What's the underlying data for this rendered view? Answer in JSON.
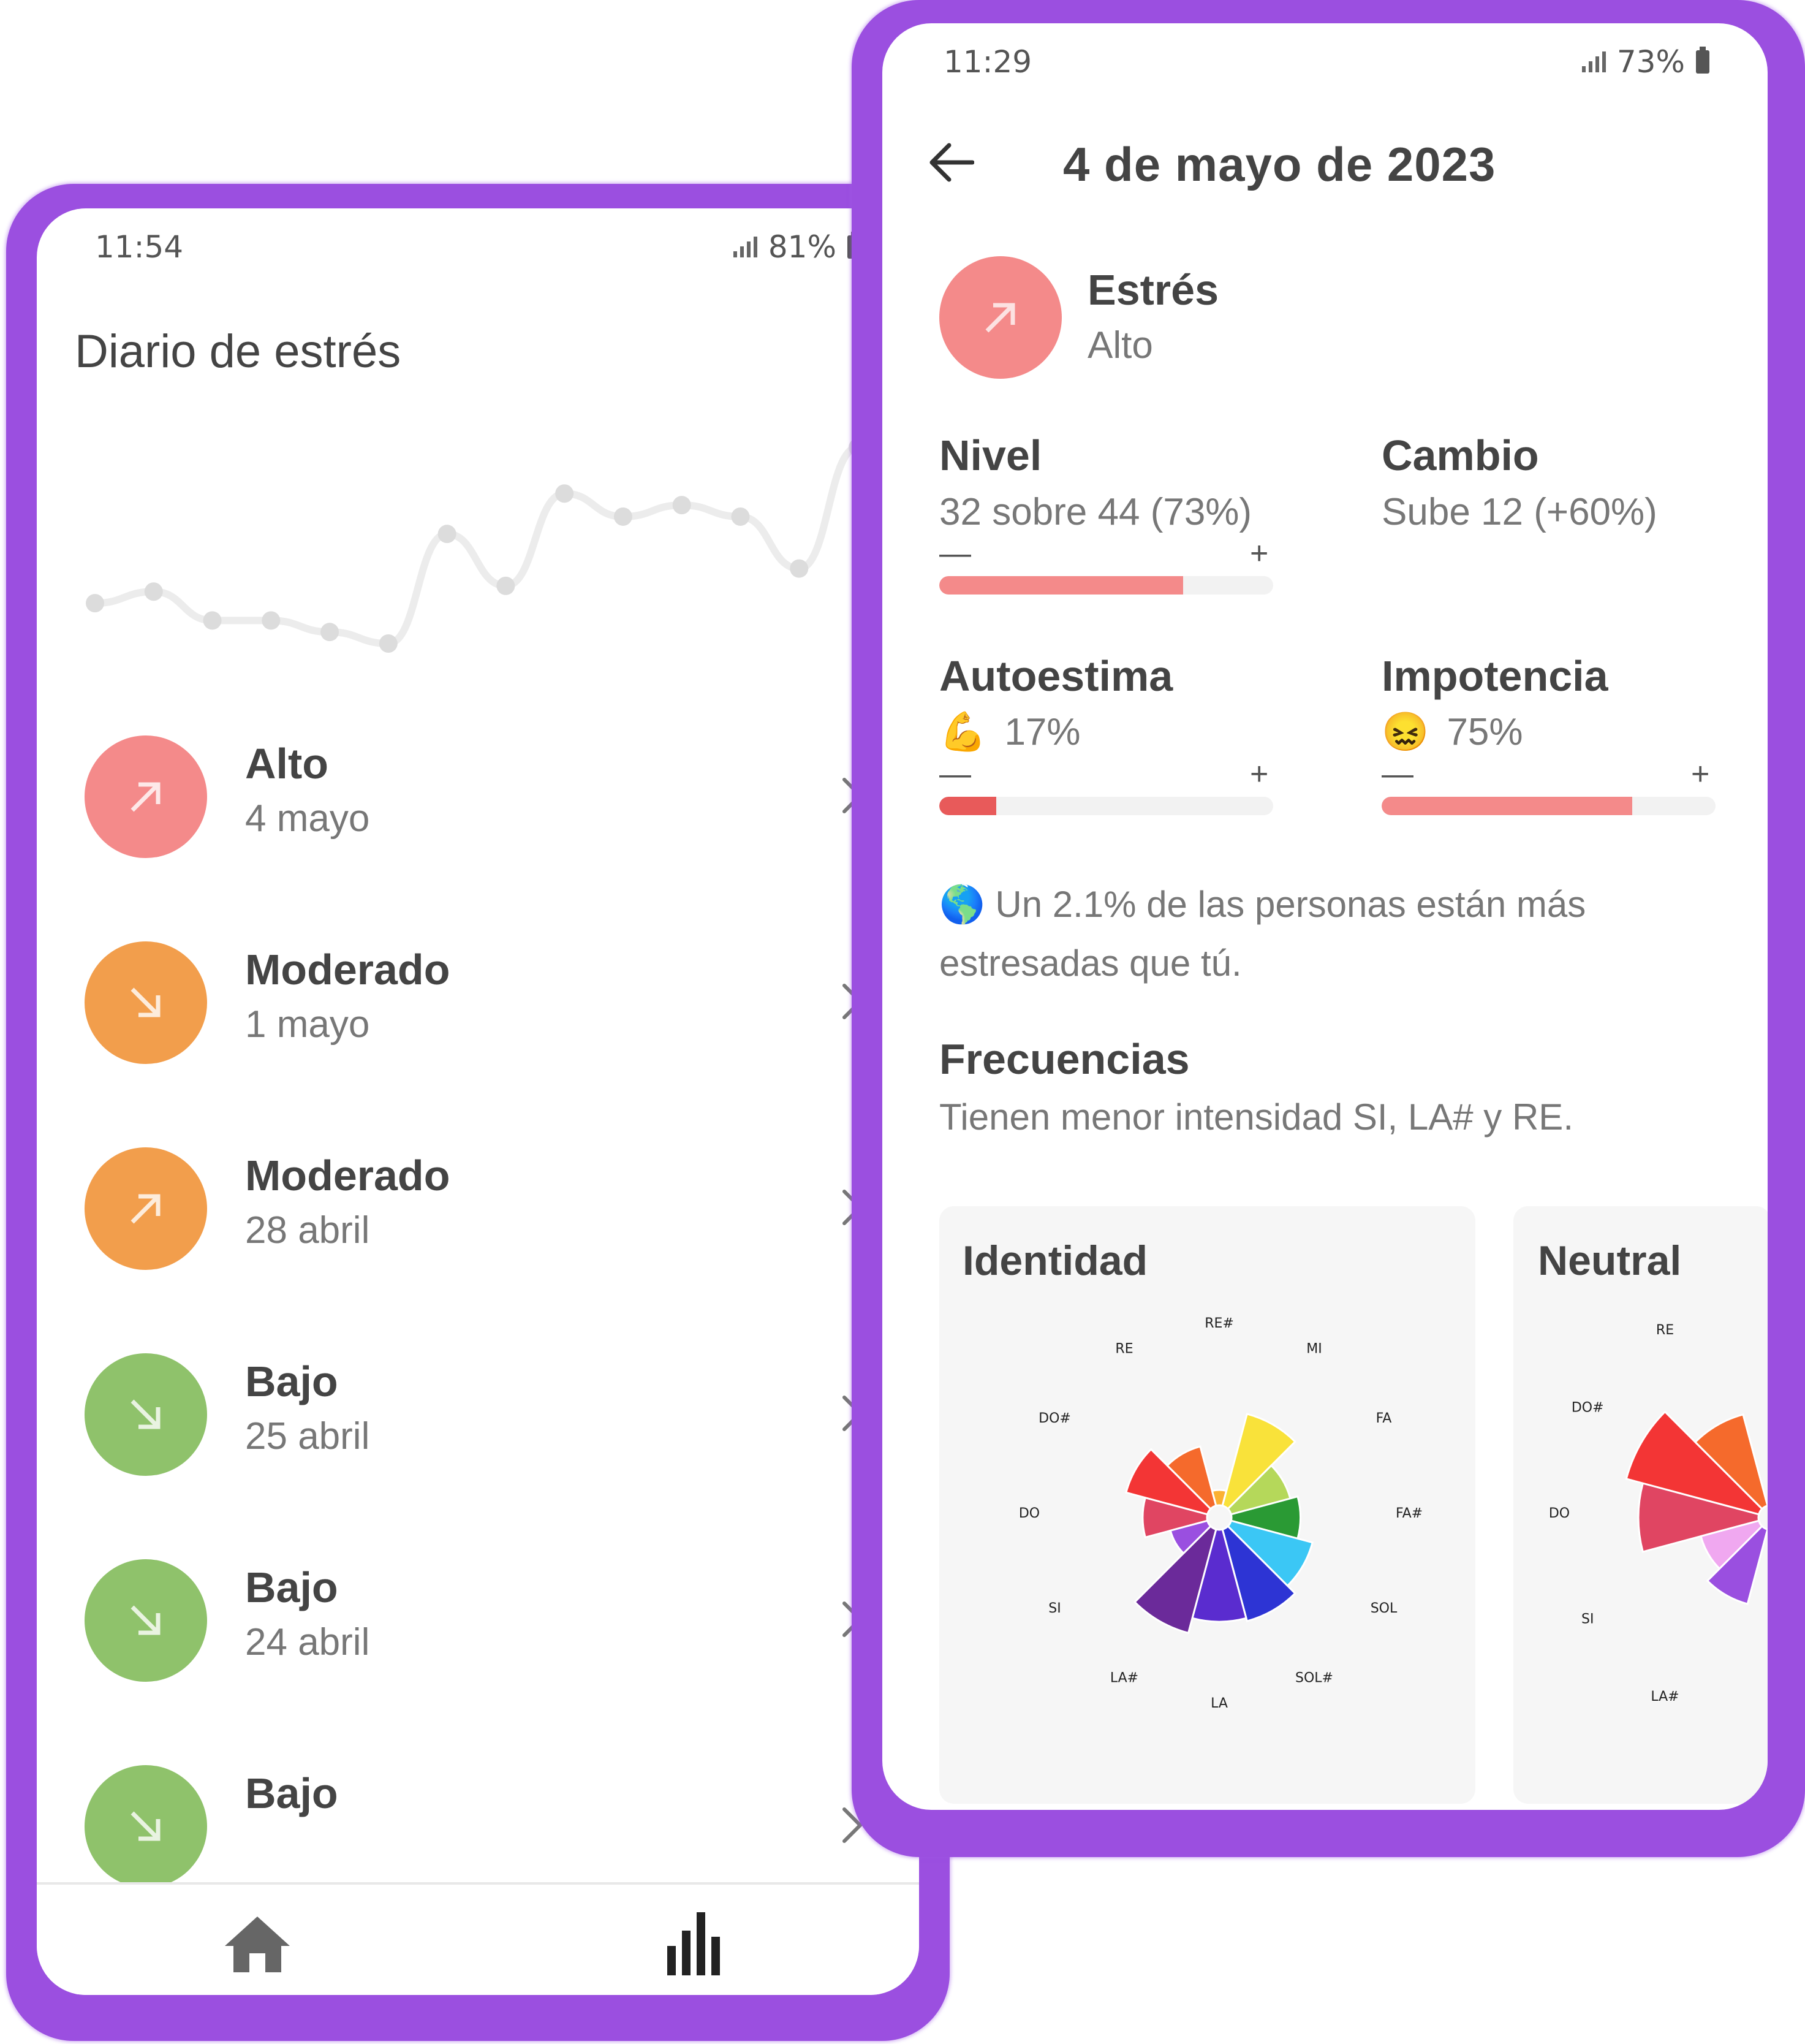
{
  "left_phone": {
    "status": {
      "time": "11:54",
      "battery": "81%"
    },
    "title": "Diario de estrés",
    "trend_points": [
      3,
      5,
      0,
      0,
      -2,
      -4,
      15,
      6,
      22,
      18,
      20,
      18,
      9,
      30
    ],
    "entries": [
      {
        "level": "Alto",
        "date": "4 mayo",
        "color": "#f48a8a",
        "arrow": "up-right-arrow-icon"
      },
      {
        "level": "Moderado",
        "date": "1 mayo",
        "color": "#f29e4c",
        "arrow": "down-right-arrow-icon"
      },
      {
        "level": "Moderado",
        "date": "28 abril",
        "color": "#f29e4c",
        "arrow": "up-right-arrow-icon"
      },
      {
        "level": "Bajo",
        "date": "25 abril",
        "color": "#8fc26b",
        "arrow": "down-right-arrow-icon"
      },
      {
        "level": "Bajo",
        "date": "24 abril",
        "color": "#8fc26b",
        "arrow": "down-right-arrow-icon"
      },
      {
        "level": "Bajo",
        "date": "",
        "color": "#8fc26b",
        "arrow": "down-right-arrow-icon"
      }
    ],
    "nav": [
      "home-icon",
      "bar-chart-icon"
    ]
  },
  "right_phone": {
    "status": {
      "time": "11:29",
      "battery": "73%"
    },
    "header_title": "4 de mayo de 2023",
    "stress": {
      "title": "Estrés",
      "value": "Alto",
      "color": "#f48a8a"
    },
    "nivel": {
      "title": "Nivel",
      "value": "32 sobre 44 (73%)",
      "fraction": 0.73,
      "color": "#f48a8a"
    },
    "cambio": {
      "title": "Cambio",
      "value": "Sube 12 (+60%)"
    },
    "autoestima": {
      "title": "Autoestima",
      "value": "17%",
      "emoji": "💪",
      "fraction": 0.17,
      "color": "#e85a5a"
    },
    "impotencia": {
      "title": "Impotencia",
      "value": "75%",
      "emoji": "😖",
      "fraction": 0.75,
      "color": "#f48a8a"
    },
    "minus": "—",
    "plus": "+",
    "info": {
      "emoji": "🌎",
      "line1": "Un 2.1% de las personas están más",
      "line2": "estresadas que tú."
    },
    "freq": {
      "title": "Frecuencias",
      "text": "Tienen menor intensidad SI, LA# y RE."
    },
    "cards": [
      {
        "title": "Identidad",
        "labels": [
          "DO",
          "DO#",
          "RE",
          "RE#",
          "MI",
          "FA",
          "FA#",
          "SOL",
          "SOL#",
          "LA",
          "LA#",
          "SI"
        ],
        "values": [
          0.42,
          0.55,
          0.4,
          0.1,
          0.62,
          0.4,
          0.45,
          0.55,
          0.62,
          0.6,
          0.7,
          0.25
        ],
        "colors": [
          "#e04562",
          "#f33535",
          "#f56a2c",
          "#fbb133",
          "#f9e23a",
          "#b5d85a",
          "#2a9a34",
          "#3bc7f5",
          "#2d34d4",
          "#5a2ccf",
          "#6b2a9a",
          "#9a4fe0"
        ]
      },
      {
        "title": "Neutral",
        "labels": [
          "DO",
          "DO#",
          "RE",
          "SI",
          "LA#"
        ],
        "values": [
          0.7,
          0.8,
          0.55,
          0.35,
          0.45
        ],
        "colors": [
          "#e04562",
          "#f33535",
          "#f56a2c",
          "#f0a8f0",
          "#9a4fe0"
        ]
      }
    ]
  }
}
